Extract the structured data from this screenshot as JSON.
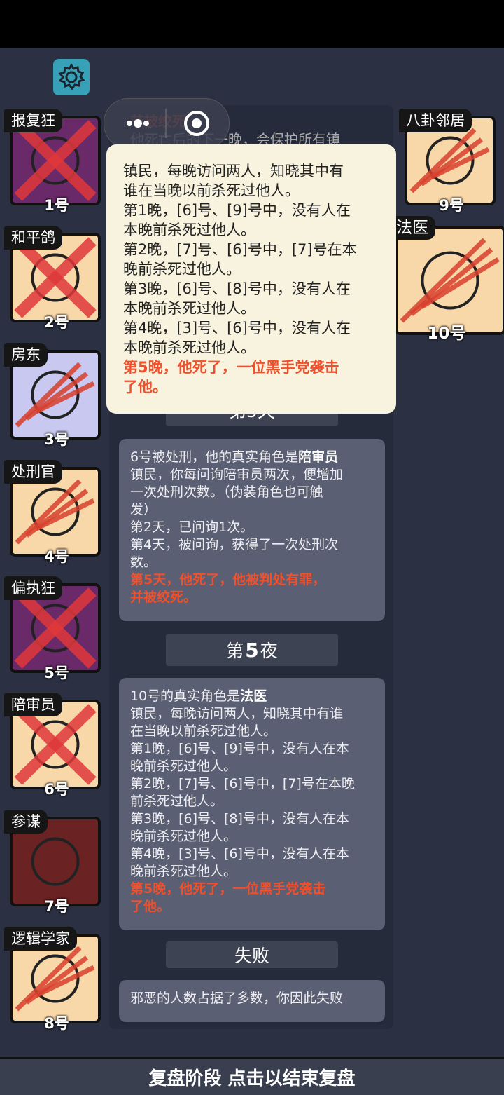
{
  "players": [
    {
      "role": "报复狂",
      "num": "1号",
      "color": "#6a2a6a"
    },
    {
      "role": "和平鸽",
      "num": "2号",
      "color": "#f8d7a8"
    },
    {
      "role": "房东",
      "num": "3号",
      "color": "#c8c8f0"
    },
    {
      "role": "处刑官",
      "num": "4号",
      "color": "#f8d7a8"
    },
    {
      "role": "偏执狂",
      "num": "5号",
      "color": "#6a2a6a"
    },
    {
      "role": "陪审员",
      "num": "6号",
      "color": "#f8d7a8"
    },
    {
      "role": "参谋",
      "num": "7号",
      "color": "#6a2222"
    },
    {
      "role": "逻辑学家",
      "num": "8号",
      "color": "#f8d7a8"
    },
    {
      "role": "八卦邻居",
      "num": "9号",
      "color": "#f8d7a8"
    },
    {
      "role": "法医",
      "num": "10号",
      "color": "#f8d7a8"
    }
  ],
  "popup": {
    "ghost_title": "节被绞死",
    "ghost_line": "他死亡后的下一晚，会保护所有镇",
    "lines": [
      "镇民，每晚访问两人，知晓其中有",
      "谁在当晚以前杀死过他人。",
      "第1晚，[6]号、[9]号中，没有人在",
      "本晚前杀死过他人。",
      "第2晚，[7]号、[6]号中，[7]号在本",
      "晚前杀死过他人。",
      "第3晚，[6]号、[8]号中，没有人在",
      "本晚前杀死过他人。",
      "第4晚，[3]号、[6]号中，没有人在",
      "本晚前杀死过他人。"
    ],
    "red_lines": [
      "第5晚，他死了，一位黑手党袭击",
      "了他。"
    ]
  },
  "day5_header_partial": "第5天",
  "entry1": {
    "title_prefix": "6号被处刑，他的真实角色是",
    "title_role": "陪审员",
    "lines": [
      "镇民，你每问询陪审员两次，便增加",
      "一次处刑次数。（伪装角色也可触",
      "发）",
      "第2天，已问询1次。",
      "第4天，被问询，获得了一次处刑次",
      "数。"
    ],
    "red_lines": [
      "第5天，他死了，他被判处有罪，",
      "并被绞死。"
    ]
  },
  "night5": {
    "prefix": "第",
    "num": "5",
    "suffix": "夜"
  },
  "entry2": {
    "title_prefix": "10号的真实角色是",
    "title_role": "法医",
    "lines": [
      "镇民，每晚访问两人，知晓其中有谁",
      "在当晚以前杀死过他人。",
      "第1晚，[6]号、[9]号中，没有人在本",
      "晚前杀死过他人。",
      "第2晚，[7]号、[6]号中，[7]号在本晚",
      "前杀死过他人。",
      "第3晚，[6]号、[8]号中，没有人在本",
      "晚前杀死过他人。",
      "第4晚，[3]号、[6]号中，没有人在本",
      "晚前杀死过他人。"
    ],
    "red_lines": [
      "第5晚，他死了，一位黑手党袭击",
      "了他。"
    ]
  },
  "fail_header": "失败",
  "fail_text": "邪恶的人数占据了多数，你因此失败",
  "bottom_label": "复盘阶段 点击以结束复盘"
}
